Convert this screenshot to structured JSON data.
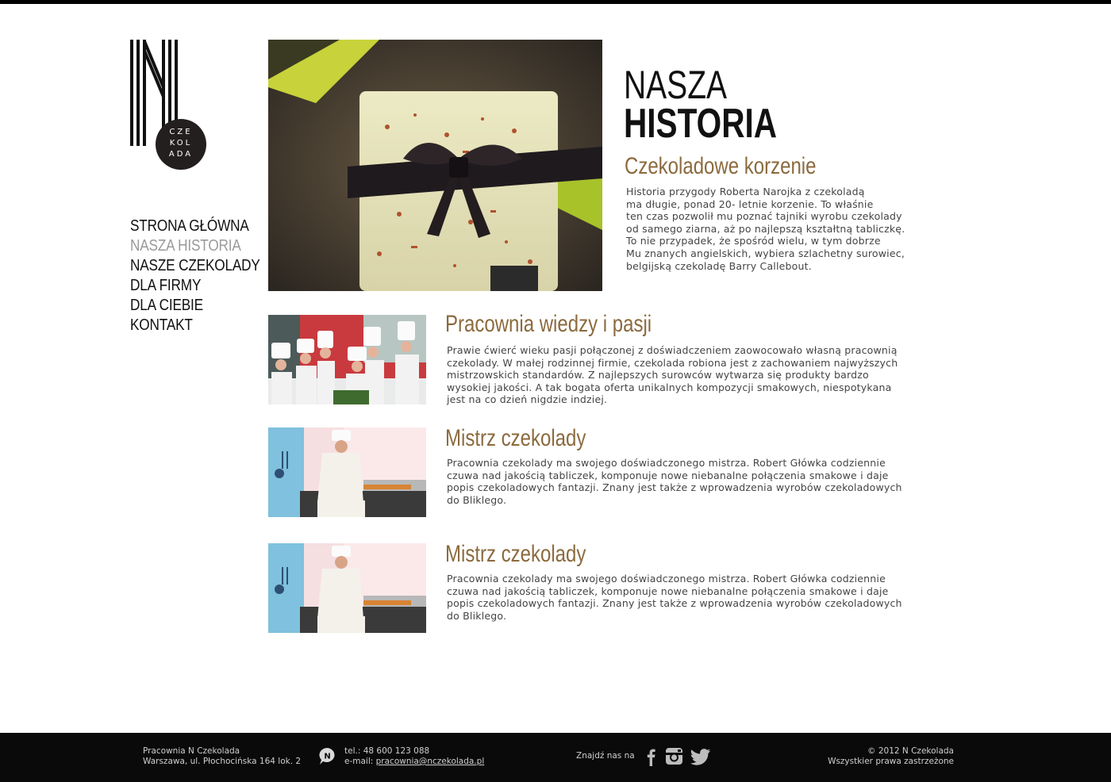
{
  "logo": {
    "circle_lines": [
      "CZE",
      "KOL",
      "ADA"
    ]
  },
  "nav": {
    "items": [
      {
        "label": "STRONA GŁÓWNA",
        "active": false
      },
      {
        "label": "NASZA HISTORIA",
        "active": true
      },
      {
        "label": "NASZE CZEKOLADY",
        "active": false
      },
      {
        "label": "DLA FIRMY",
        "active": false
      },
      {
        "label": "DLA CIEBIE",
        "active": false
      },
      {
        "label": "KONTAKT",
        "active": false
      }
    ]
  },
  "page_title": {
    "line1": "NASZA",
    "line2": "HISTORIA"
  },
  "intro": {
    "title": "Czekoladowe korzenie",
    "lines": [
      "Historia przygody Roberta Narojka z czekoladą",
      "ma długie, ponad 20- letnie korzenie. To właśnie",
      "ten czas pozwolił mu poznać tajniki wyrobu czekolady",
      "od samego ziarna, aż po najlepszą kształtną tabliczkę.",
      "To nie przypadek, że spośród  wielu, w tym dobrze",
      "Mu znanych angielskich, wybiera szlachetny surowiec,",
      "belgijską czekoladę Barry Callebout."
    ]
  },
  "sections": [
    {
      "title": "Pracownia wiedzy i pasji",
      "lines": [
        "Prawie ćwierć wieku pasji połączonej z doświadczeniem zaowocowało własną pracownią",
        "czekolady. W małej rodzinnej firmie, czekolada robiona jest z zachowaniem najwyższych",
        "mistrzowskich standardów.  Z najlepszych surowców wytwarza się produkty bardzo",
        "wysokiej jakości. A tak bogata oferta unikalnych kompozycji smakowych, niespotykana",
        "jest na co dzień nigdzie indziej."
      ]
    },
    {
      "title": "Mistrz czekolady",
      "lines": [
        "Pracownia czekolady ma swojego doświadczonego mistrza. Robert Główka codziennie",
        "czuwa nad jakością tabliczek, komponuje nowe niebanalne połączenia smakowe i daje",
        "popis czekoladowych fantazji. Znany jest także z wprowadzenia wyrobów czekoladowych",
        "do Bliklego."
      ]
    },
    {
      "title": "Mistrz czekolady",
      "lines": [
        "Pracownia czekolady ma swojego doświadczonego mistrza. Robert Główka codziennie",
        "czuwa nad jakością tabliczek, komponuje nowe niebanalne połączenia smakowe i daje",
        "popis czekoladowych fantazji. Znany jest także z wprowadzenia wyrobów czekoladowych",
        "do Bliklego."
      ]
    }
  ],
  "footer": {
    "address_line1": "Pracownia N Czekolada",
    "address_line2": "Warszawa, ul. Płochocińska  164 lok. 2",
    "icon_letter": "N",
    "phone": "tel.: 48 600 123 088",
    "email_label": "e-mail: ",
    "email": "pracownia@nczekolada.pl",
    "find_us": "Znajdź nas na",
    "social": [
      "facebook-icon",
      "instagram-icon",
      "twitter-icon"
    ],
    "copyright": "© 2012 N Czekolada",
    "rights": "Wszystkier prawa zastrzeżone"
  },
  "colors": {
    "accent": "#8b6a3e",
    "nav_active": "#9a9a9a",
    "footer_bg": "#0a0a0a"
  }
}
